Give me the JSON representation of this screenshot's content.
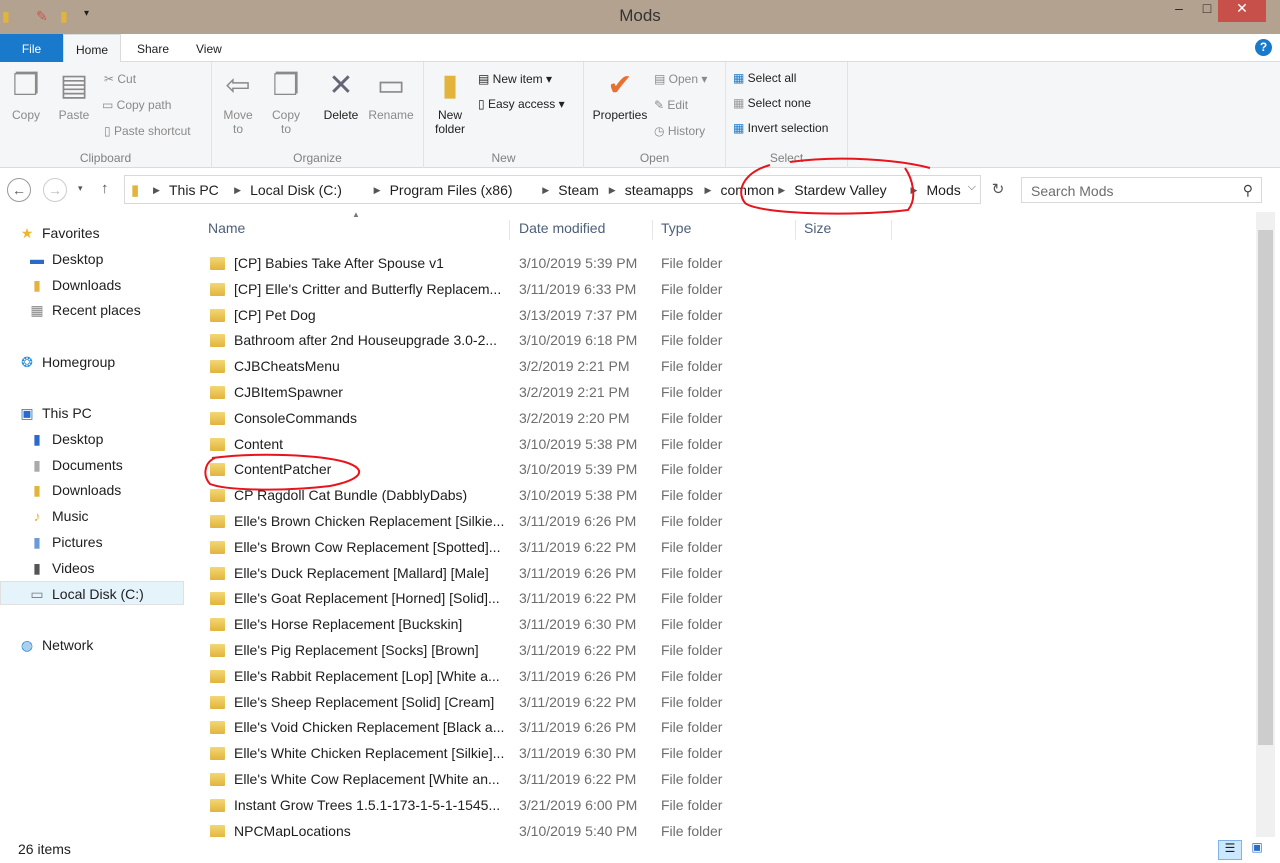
{
  "window": {
    "title": "Mods",
    "minimize": "–",
    "maximize": "□",
    "close": "✕"
  },
  "tabs": [
    {
      "label": "File"
    },
    {
      "label": "Home"
    },
    {
      "label": "Share"
    },
    {
      "label": "View"
    }
  ],
  "ribbon": {
    "clipboard": {
      "label": "Clipboard",
      "copy": "Copy",
      "paste": "Paste",
      "cut": "Cut",
      "copy_path": "Copy path",
      "paste_shortcut": "Paste shortcut"
    },
    "organize": {
      "label": "Organize",
      "move_to": "Move\nto",
      "copy_to": "Copy\nto",
      "delete": "Delete",
      "rename": "Rename"
    },
    "new": {
      "label": "New",
      "new_folder": "New\nfolder",
      "new_item": "New item",
      "easy_access": "Easy access"
    },
    "open": {
      "label": "Open",
      "properties": "Properties",
      "open": "Open",
      "edit": "Edit",
      "history": "History"
    },
    "select": {
      "label": "Select",
      "select_all": "Select all",
      "select_none": "Select none",
      "invert": "Invert selection"
    }
  },
  "address": {
    "crumbs": [
      "This PC",
      "Local Disk (C:)",
      "Program Files (x86)",
      "Steam",
      "steamapps",
      "common",
      "Stardew Valley",
      "Mods"
    ]
  },
  "search": {
    "placeholder": "Search Mods"
  },
  "nav": {
    "favorites": "Favorites",
    "desktop": "Desktop",
    "downloads": "Downloads",
    "recent": "Recent places",
    "homegroup": "Homegroup",
    "thispc": "This PC",
    "pc_desktop": "Desktop",
    "documents": "Documents",
    "pc_downloads": "Downloads",
    "music": "Music",
    "pictures": "Pictures",
    "videos": "Videos",
    "localdisk": "Local Disk (C:)",
    "network": "Network"
  },
  "columns": {
    "name": "Name",
    "date": "Date modified",
    "type": "Type",
    "size": "Size"
  },
  "files": [
    [
      "[CP] Babies Take After Spouse v1",
      "3/10/2019 5:39 PM",
      "File folder"
    ],
    [
      "[CP] Elle's Critter and Butterfly Replacem...",
      "3/11/2019 6:33 PM",
      "File folder"
    ],
    [
      "[CP] Pet Dog",
      "3/13/2019 7:37 PM",
      "File folder"
    ],
    [
      "Bathroom after 2nd Houseupgrade 3.0-2...",
      "3/10/2019 6:18 PM",
      "File folder"
    ],
    [
      "CJBCheatsMenu",
      "3/2/2019 2:21 PM",
      "File folder"
    ],
    [
      "CJBItemSpawner",
      "3/2/2019 2:21 PM",
      "File folder"
    ],
    [
      "ConsoleCommands",
      "3/2/2019 2:20 PM",
      "File folder"
    ],
    [
      "Content",
      "3/10/2019 5:38 PM",
      "File folder"
    ],
    [
      "ContentPatcher",
      "3/10/2019 5:39 PM",
      "File folder"
    ],
    [
      "CP Ragdoll Cat Bundle (DabblyDabs)",
      "3/10/2019 5:38 PM",
      "File folder"
    ],
    [
      "Elle's Brown Chicken Replacement [Silkie...",
      "3/11/2019 6:26 PM",
      "File folder"
    ],
    [
      "Elle's Brown Cow Replacement [Spotted]...",
      "3/11/2019 6:22 PM",
      "File folder"
    ],
    [
      "Elle's Duck Replacement [Mallard] [Male]",
      "3/11/2019 6:26 PM",
      "File folder"
    ],
    [
      "Elle's Goat Replacement [Horned] [Solid]...",
      "3/11/2019 6:22 PM",
      "File folder"
    ],
    [
      "Elle's Horse Replacement [Buckskin]",
      "3/11/2019 6:30 PM",
      "File folder"
    ],
    [
      "Elle's Pig Replacement [Socks] [Brown]",
      "3/11/2019 6:22 PM",
      "File folder"
    ],
    [
      "Elle's Rabbit Replacement [Lop] [White a...",
      "3/11/2019 6:26 PM",
      "File folder"
    ],
    [
      "Elle's Sheep Replacement [Solid] [Cream]",
      "3/11/2019 6:22 PM",
      "File folder"
    ],
    [
      "Elle's Void Chicken Replacement [Black a...",
      "3/11/2019 6:26 PM",
      "File folder"
    ],
    [
      "Elle's White Chicken Replacement [Silkie]...",
      "3/11/2019 6:30 PM",
      "File folder"
    ],
    [
      "Elle's White Cow Replacement [White an...",
      "3/11/2019 6:22 PM",
      "File folder"
    ],
    [
      "Instant Grow Trees 1.5.1-173-1-5-1-1545...",
      "3/21/2019 6:00 PM",
      "File folder"
    ],
    [
      "NPCMapLocations",
      "3/10/2019 5:40 PM",
      "File folder"
    ]
  ],
  "status": {
    "count": "26 items"
  },
  "colors": {
    "accent": "#1979ca",
    "titlebar": "#b4a291",
    "annotation": "#e8141b"
  }
}
